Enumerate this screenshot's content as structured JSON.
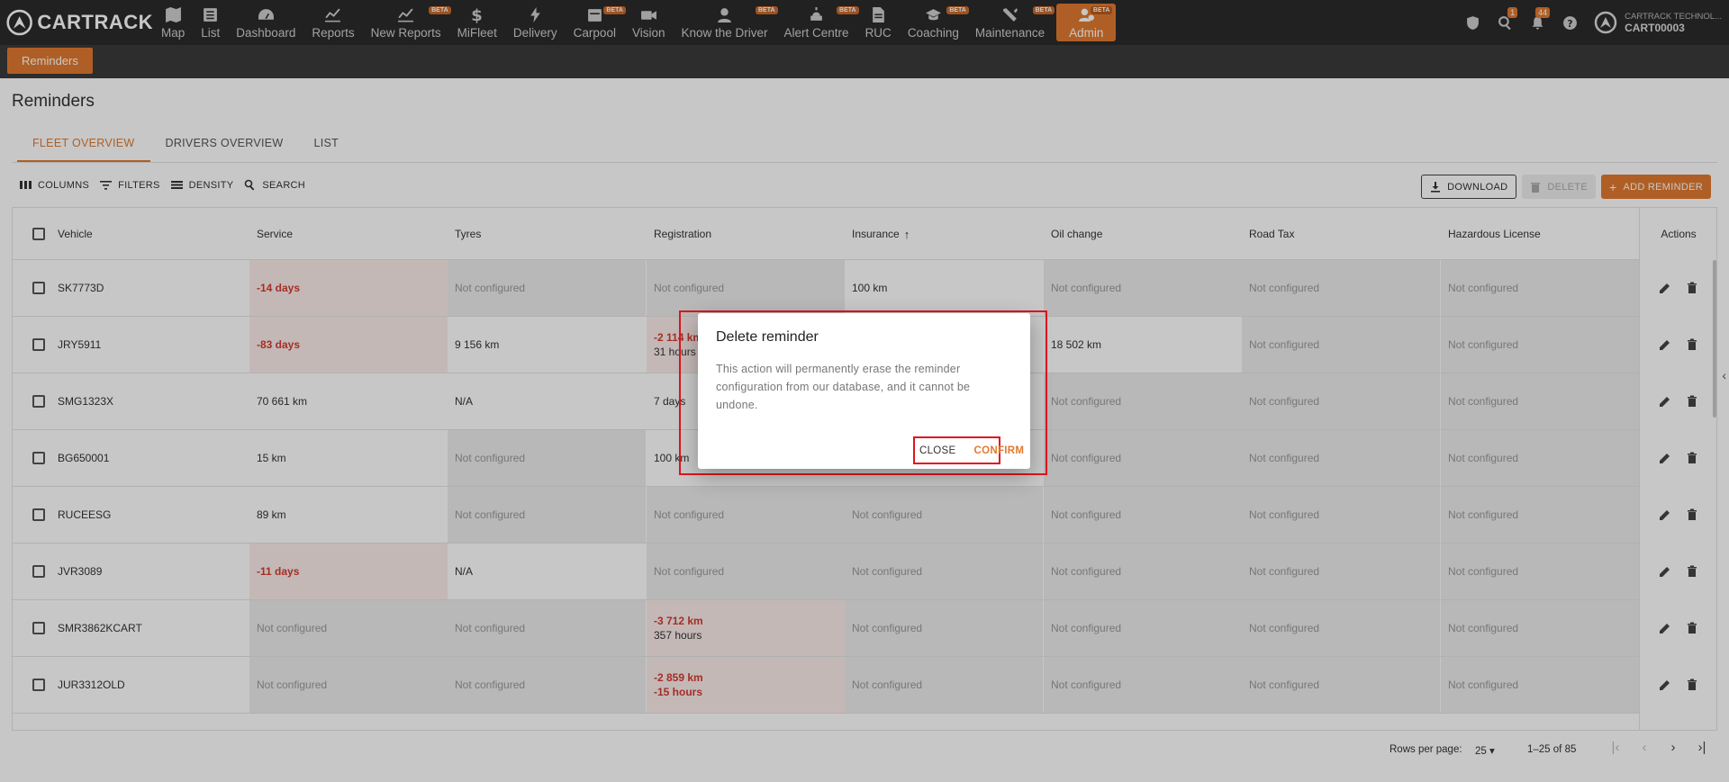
{
  "brand": {
    "name": "CARTRACK",
    "accent": "#e07a30"
  },
  "nav": [
    {
      "label": "Map",
      "icon": "map-icon",
      "beta": ""
    },
    {
      "label": "List",
      "icon": "list-icon",
      "beta": ""
    },
    {
      "label": "Dashboard",
      "icon": "dashboard-icon",
      "beta": ""
    },
    {
      "label": "Reports",
      "icon": "reports-icon",
      "beta": ""
    },
    {
      "label": "New Reports",
      "icon": "new-reports-icon",
      "beta": "BETA"
    },
    {
      "label": "MiFleet",
      "icon": "dollar-icon",
      "beta": ""
    },
    {
      "label": "Delivery",
      "icon": "bolt-icon",
      "beta": ""
    },
    {
      "label": "Carpool",
      "icon": "calendar-icon",
      "beta": "BETA"
    },
    {
      "label": "Vision",
      "icon": "camera-icon",
      "beta": ""
    },
    {
      "label": "Know the Driver",
      "icon": "driver-icon",
      "beta": "BETA"
    },
    {
      "label": "Alert Centre",
      "icon": "alert-icon",
      "beta": "BETA"
    },
    {
      "label": "RUC",
      "icon": "document-icon",
      "beta": ""
    },
    {
      "label": "Coaching",
      "icon": "graduation-cap-icon",
      "beta": "BETA"
    },
    {
      "label": "Maintenance",
      "icon": "wrench-icon",
      "beta": "BETA"
    },
    {
      "label": "Admin",
      "icon": "admin-icon",
      "beta": "BETA"
    }
  ],
  "header_right": {
    "search_count": "1",
    "notification_count": "44",
    "account_company": "CARTRACK TECHNOL...",
    "account_id": "CART00003"
  },
  "subbar": {
    "tab": "Reminders"
  },
  "page": {
    "title": "Reminders"
  },
  "tabs": [
    "FLEET OVERVIEW",
    "DRIVERS OVERVIEW",
    "LIST"
  ],
  "toolbar": {
    "columns": "COLUMNS",
    "filters": "FILTERS",
    "density": "DENSITY",
    "search": "SEARCH",
    "download": "DOWNLOAD",
    "delete": "DELETE",
    "add": "ADD REMINDER"
  },
  "columns": [
    "Vehicle",
    "Service",
    "Tyres",
    "Registration",
    "Insurance",
    "Oil change",
    "Road Tax",
    "Hazardous License",
    "Actions"
  ],
  "rows": [
    {
      "vehicle": "SK7773D",
      "service": "-14 days",
      "tyres": "Not configured",
      "registration": "Not configured",
      "registration2": "",
      "insurance": "100 km",
      "oil": "Not configured",
      "roadtax": "Not configured",
      "hazard": "Not configured"
    },
    {
      "vehicle": "JRY5911",
      "service": "-83 days",
      "tyres": "9 156 km",
      "registration": "-2 114 km",
      "registration2": "31 hours",
      "insurance": "",
      "oil": "18 502 km",
      "roadtax": "Not configured",
      "hazard": "Not configured"
    },
    {
      "vehicle": "SMG1323X",
      "service": "70 661 km",
      "tyres": "N/A",
      "registration": "7 days",
      "registration2": "",
      "insurance": "",
      "oil": "Not configured",
      "roadtax": "Not configured",
      "hazard": "Not configured"
    },
    {
      "vehicle": "BG650001",
      "service": "15 km",
      "tyres": "Not configured",
      "registration": "100 km",
      "registration2": "",
      "insurance": "",
      "oil": "Not configured",
      "roadtax": "Not configured",
      "hazard": "Not configured"
    },
    {
      "vehicle": "RUCEESG",
      "service": "89 km",
      "tyres": "Not configured",
      "registration": "Not configured",
      "registration2": "",
      "insurance": "Not configured",
      "oil": "Not configured",
      "roadtax": "Not configured",
      "hazard": "Not configured"
    },
    {
      "vehicle": "JVR3089",
      "service": "-11 days",
      "tyres": "N/A",
      "registration": "Not configured",
      "registration2": "",
      "insurance": "Not configured",
      "oil": "Not configured",
      "roadtax": "Not configured",
      "hazard": "Not configured"
    },
    {
      "vehicle": "SMR3862KCART",
      "service": "Not configured",
      "tyres": "Not configured",
      "registration": "-3 712 km",
      "registration2": "357 hours",
      "insurance": "Not configured",
      "oil": "Not configured",
      "roadtax": "Not configured",
      "hazard": "Not configured"
    },
    {
      "vehicle": "JUR3312OLD",
      "service": "Not configured",
      "tyres": "Not configured",
      "registration": "-2 859 km",
      "registration2": "-15 hours",
      "insurance": "Not configured",
      "oil": "Not configured",
      "roadtax": "Not configured",
      "hazard": "Not configured"
    }
  ],
  "footer": {
    "rows_per_page_label": "Rows per page:",
    "rows_per_page": "25",
    "range": "1–25 of 85"
  },
  "modal": {
    "title": "Delete reminder",
    "body": "This action will permanently erase the reminder configuration from our database, and it cannot be undone.",
    "close": "CLOSE",
    "confirm": "CONFIRM"
  }
}
